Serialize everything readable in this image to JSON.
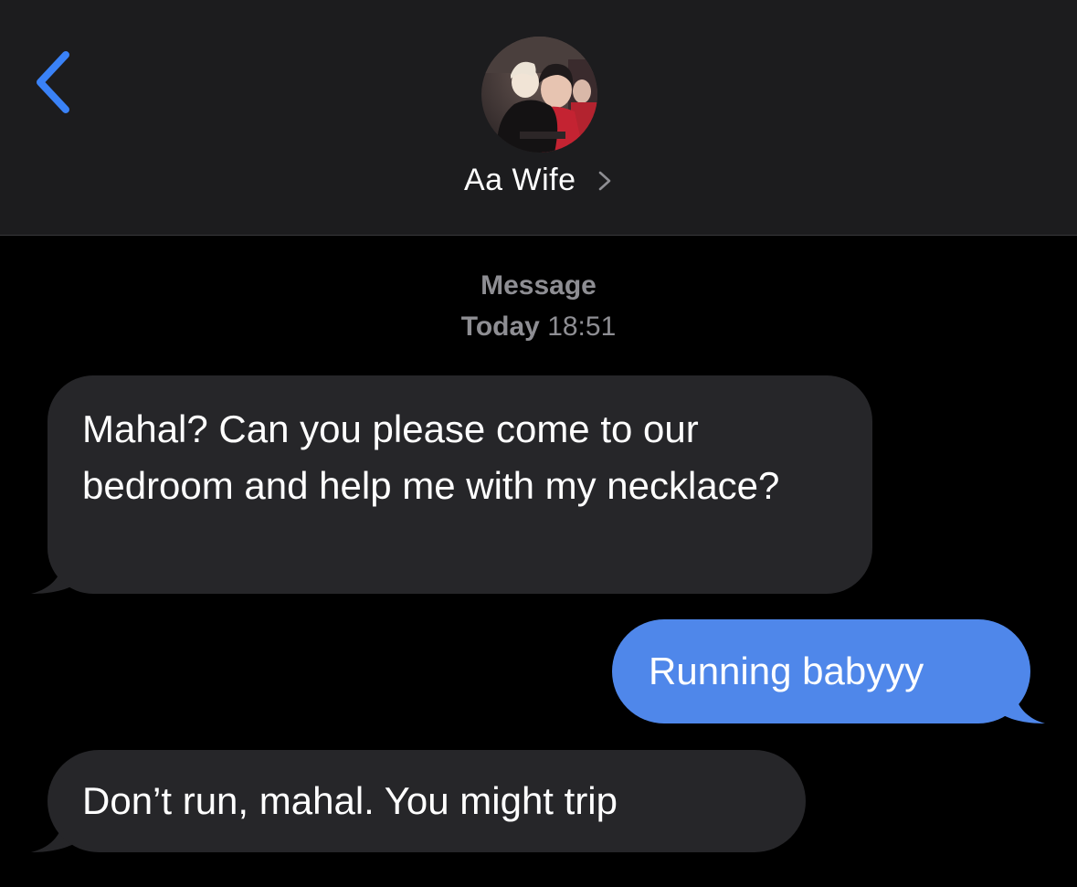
{
  "header": {
    "back_icon": "chevron-left-icon",
    "contact_name": "Aa Wife",
    "contact_chevron_icon": "chevron-right-icon",
    "avatar_description_icon": "contact-photo"
  },
  "thread": {
    "service_label": "Message",
    "timestamp_day": "Today",
    "timestamp_time": "18:51"
  },
  "messages": [
    {
      "direction": "incoming",
      "text": "Mahal? Can you please come to our bedroom and help me with my necklace?"
    },
    {
      "direction": "outgoing",
      "text": "Running babyyy"
    },
    {
      "direction": "incoming",
      "text": "Don’t run, mahal. You might trip"
    }
  ],
  "colors": {
    "accent": "#3a82f7",
    "incoming_bubble": "#262629",
    "outgoing_bubble": "#4f87ea",
    "header_bg": "#1c1c1e",
    "meta_text": "#8e8e93"
  }
}
